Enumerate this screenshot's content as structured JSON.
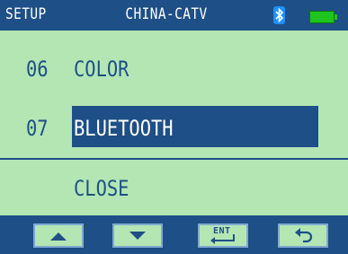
{
  "header": {
    "left_label": "SETUP",
    "title": "CHINA-CATV",
    "icons": [
      "bluetooth-icon",
      "battery-icon"
    ]
  },
  "menu": {
    "items": [
      {
        "number": "06",
        "label": "COLOR",
        "selected": false
      },
      {
        "number": "07",
        "label": "BLUETOOTH",
        "selected": true
      }
    ],
    "close_label": "CLOSE"
  },
  "footer": {
    "buttons": [
      {
        "name": "up",
        "icon": "triangle-up-icon"
      },
      {
        "name": "down",
        "icon": "triangle-down-icon"
      },
      {
        "name": "enter",
        "label": "ENT",
        "icon": "enter-icon"
      },
      {
        "name": "back",
        "icon": "undo-arrow-icon"
      }
    ]
  },
  "colors": {
    "background": "#b4e6b4",
    "accent": "#1e4f86",
    "battery": "#1ec31e",
    "bluetooth": "#1e90ff"
  }
}
